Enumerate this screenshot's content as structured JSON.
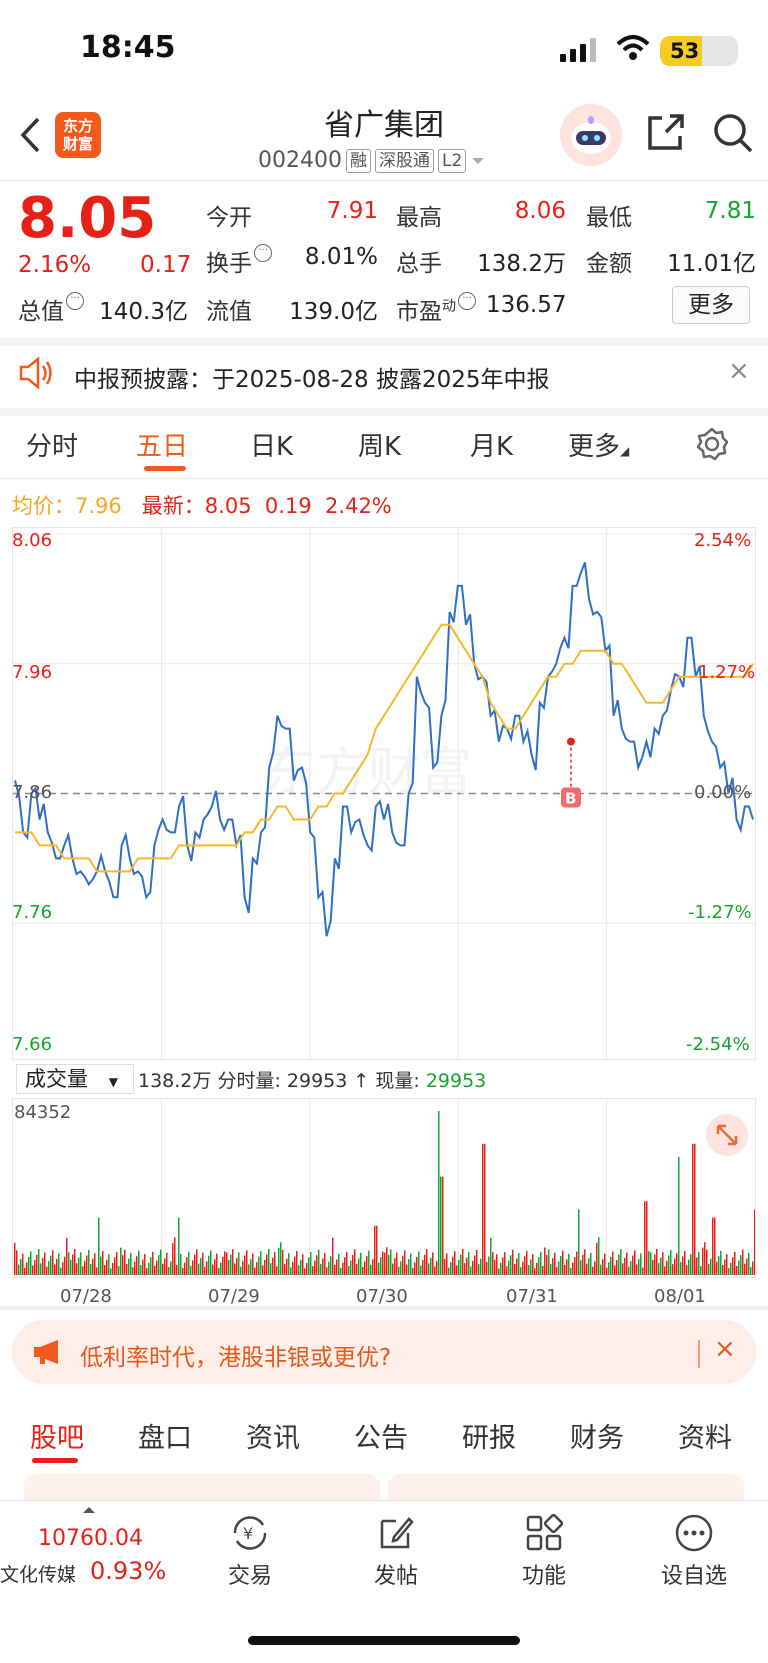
{
  "status_bar": {
    "time": "18:45",
    "battery": "53"
  },
  "header": {
    "logo_line1": "东方",
    "logo_line2": "财富",
    "stock_name": "省广集团",
    "stock_code": "002400",
    "tags": [
      "融",
      "深股通",
      "L2"
    ]
  },
  "quote": {
    "price": "8.05",
    "change_pct": "2.16%",
    "change_amt": "0.17",
    "rows": [
      [
        {
          "label": "今开",
          "value": "7.91",
          "color": "red"
        },
        {
          "label": "最高",
          "value": "8.06",
          "color": "red"
        },
        {
          "label": "最低",
          "value": "7.81",
          "color": "green"
        }
      ],
      [
        {
          "label": "换手",
          "value": "8.01%",
          "color": "black"
        },
        {
          "label": "总手",
          "value": "138.2万",
          "color": "black"
        },
        {
          "label": "金额",
          "value": "11.01亿",
          "color": "black"
        }
      ],
      [
        {
          "label": "总值",
          "value": "140.3亿",
          "color": "black"
        },
        {
          "label": "流值",
          "value": "139.0亿",
          "color": "black"
        },
        {
          "label": "市盈",
          "value": "136.57",
          "color": "black"
        }
      ]
    ],
    "pe_superscript": "动",
    "more_label": "更多"
  },
  "notice": {
    "text": "中报预披露：于2025-08-28 披露2025年中报",
    "close": "×"
  },
  "chart_tabs": [
    "分时",
    "五日",
    "日K",
    "周K",
    "月K",
    "更多"
  ],
  "legend": {
    "avg_label": "均价：",
    "avg_value": "7.96",
    "latest_label": "最新：",
    "latest_value": "8.05",
    "latest_chg": "0.19",
    "latest_pct": "2.42%"
  },
  "chart_data": {
    "type": "line",
    "x_dates": [
      "07/28",
      "07/29",
      "07/30",
      "07/31",
      "08/01"
    ],
    "y_labels_left": [
      "8.06",
      "7.96",
      "7.86",
      "7.76",
      "7.66"
    ],
    "y_labels_right": [
      "2.54%",
      "1.27%",
      "0.00%",
      "-1.27%",
      "-2.54%"
    ],
    "ylim": [
      7.66,
      8.06
    ],
    "prev_close": 7.86,
    "series": [
      {
        "name": "price",
        "color": "#2f6fc4",
        "values": [
          7.87,
          7.83,
          7.86,
          7.84,
          7.83,
          7.81,
          7.82,
          7.81,
          7.8,
          7.79,
          7.8,
          7.8,
          7.78,
          7.82,
          7.81,
          7.8,
          7.78,
          7.82,
          7.84,
          7.83,
          7.85,
          7.82,
          7.83,
          7.84,
          7.85,
          7.84,
          7.84,
          7.82,
          7.78,
          7.81,
          7.83,
          7.88,
          7.92,
          7.91,
          7.87,
          7.88,
          7.83,
          7.78,
          7.75,
          7.81,
          7.85,
          7.83,
          7.84,
          7.82,
          7.85,
          7.84,
          7.83,
          7.82,
          7.86,
          7.95,
          7.93,
          7.88,
          7.92,
          8.0,
          8.02,
          7.99,
          7.96,
          7.95,
          7.92,
          7.9,
          7.91,
          7.92,
          7.9,
          7.89,
          7.93,
          7.95,
          7.96,
          7.98,
          8.02,
          8.03,
          8.01,
          8.0,
          7.97,
          7.92,
          7.91,
          7.9,
          7.88,
          7.9,
          7.91,
          7.92,
          7.94,
          7.95,
          7.98,
          7.95,
          7.92,
          7.9,
          7.88,
          7.86,
          7.84,
          7.85,
          7.84
        ],
        "avg": [
          7.83,
          7.83,
          7.83,
          7.82,
          7.82,
          7.82,
          7.81,
          7.81,
          7.81,
          7.81,
          7.8,
          7.8,
          7.8,
          7.8,
          7.8,
          7.81,
          7.81,
          7.81,
          7.81,
          7.81,
          7.82,
          7.82,
          7.82,
          7.82,
          7.82,
          7.82,
          7.82,
          7.82,
          7.83,
          7.83,
          7.84,
          7.84,
          7.85,
          7.85,
          7.84,
          7.84,
          7.84,
          7.85,
          7.85,
          7.86,
          7.86,
          7.87,
          7.88,
          7.89,
          7.91,
          7.92,
          7.93,
          7.94,
          7.95,
          7.96,
          7.97,
          7.98,
          7.99,
          7.99,
          7.98,
          7.97,
          7.96,
          7.95,
          7.93,
          7.92,
          7.91,
          7.91,
          7.92,
          7.93,
          7.94,
          7.95,
          7.95,
          7.96,
          7.96,
          7.97,
          7.97,
          7.97,
          7.97,
          7.96,
          7.96,
          7.95,
          7.94,
          7.93,
          7.93,
          7.93,
          7.94,
          7.95,
          7.95,
          7.95,
          7.95,
          7.95,
          7.95,
          7.95,
          7.95,
          7.95,
          7.96
        ]
      }
    ]
  },
  "volume": {
    "label": "成交量",
    "total": "138.2万",
    "seg_label": "分时量:",
    "seg_value": "29953",
    "arrow": "↑",
    "now_label": "现量:",
    "now_value": "29953",
    "max_label": "84352"
  },
  "banner": {
    "text": "低利率时代，港股非银或更优?",
    "close": "×"
  },
  "info_tabs": [
    "股吧",
    "盘口",
    "资讯",
    "公告",
    "研报",
    "财务",
    "资料"
  ],
  "bottom_nav": {
    "index_value": "10760.04",
    "index_name": "文化传媒",
    "index_pct": "0.93%",
    "items": [
      "交易",
      "发帖",
      "功能",
      "设自选"
    ]
  },
  "colors": {
    "accent": "#f25a1c",
    "up": "#e62117",
    "down": "#15a52e",
    "price_line": "#2f6fc4",
    "avg_line": "#f5b82e"
  }
}
